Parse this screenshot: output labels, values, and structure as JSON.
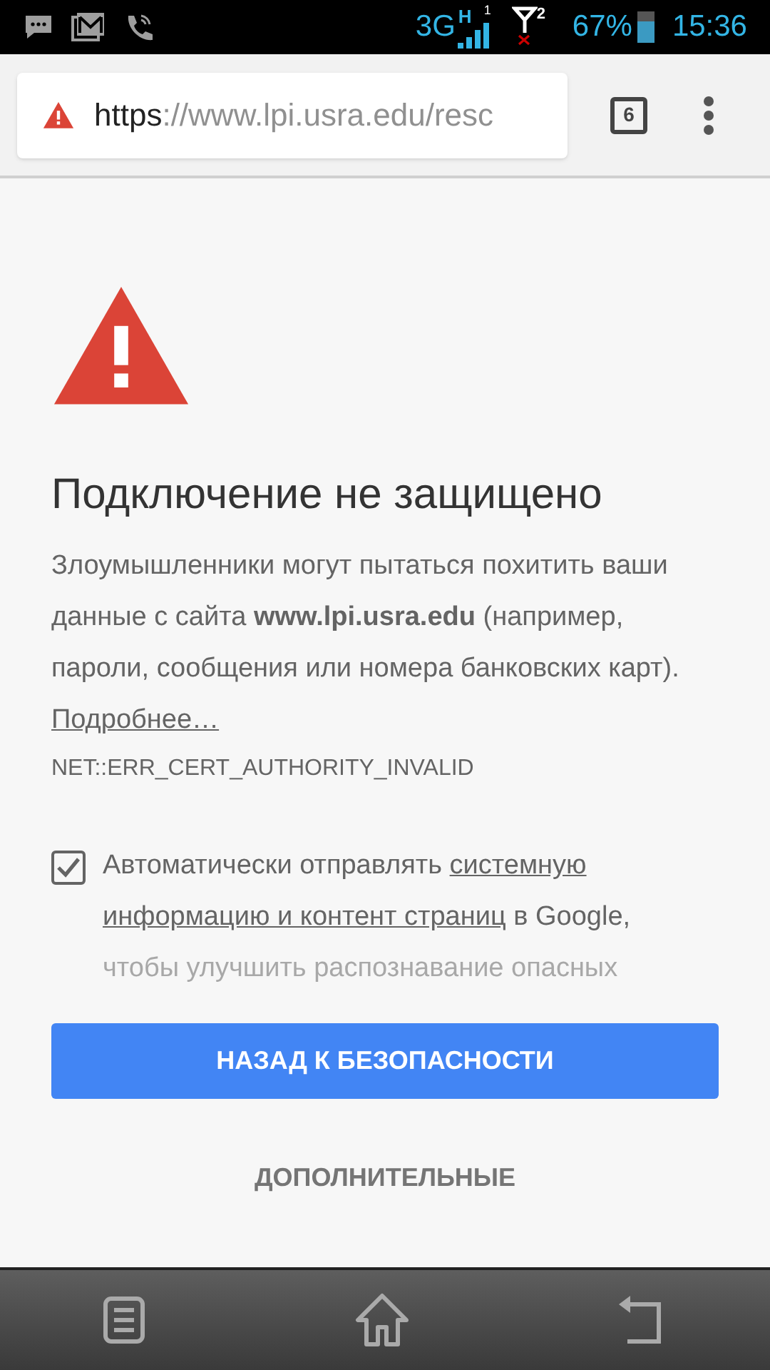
{
  "status_bar": {
    "network": "3G",
    "hspa": "H",
    "sim1": "1",
    "sim2": "2",
    "battery": "67%",
    "time": "15:36",
    "level": 0.67
  },
  "toolbar": {
    "url_scheme": "https",
    "url_rest": "://www.lpi.usra.edu/resc",
    "tab_count": "6"
  },
  "interstitial": {
    "heading": "Подключение не защищено",
    "paragraph": "Злоумышленники могут пытаться похитить ваши данные с сайта **www.lpi.usra.edu** (например, пароли, сообщения или номера банковских карт).",
    "learn_more": "Подробнее…",
    "error_code": "NET::ERR_CERT_AUTHORITY_INVALID",
    "report": {
      "checked": true,
      "parts": [
        {
          "kind": "text",
          "text": "Автоматически отправлять "
        },
        {
          "kind": "link",
          "text": "системную"
        },
        {
          "kind": "link",
          "text": "информацию и контент страниц"
        },
        {
          "kind": "text",
          "text": " в Google,"
        },
        {
          "kind": "faded",
          "text": "чтобы улучшить распознавание опасных"
        }
      ]
    },
    "primary_button": "НАЗАД К БЕЗОПАСНОСТИ",
    "details_button": "ДОПОЛНИТЕЛЬНЫЕ"
  }
}
